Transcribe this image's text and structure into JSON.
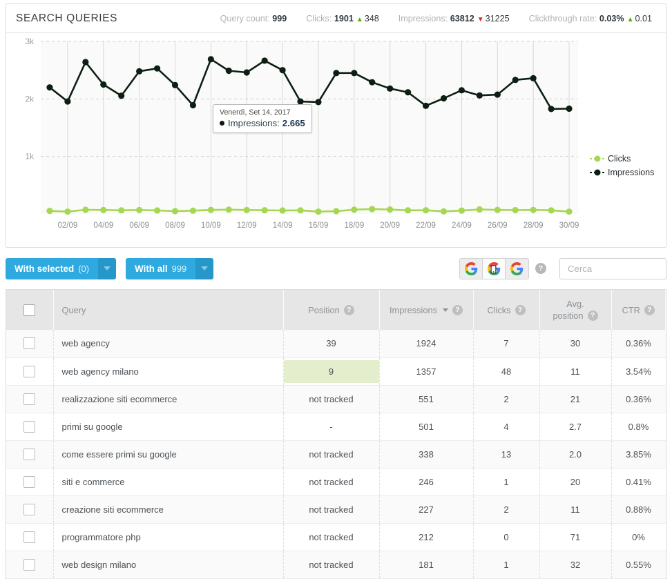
{
  "panel": {
    "title": "SEARCH QUERIES",
    "metrics": [
      {
        "label": "Query count:",
        "value": "999",
        "delta": "",
        "trend": "none"
      },
      {
        "label": "Clicks:",
        "value": "1901",
        "delta": "348",
        "trend": "up"
      },
      {
        "label": "Impressions:",
        "value": "63812",
        "delta": "31225",
        "trend": "down"
      },
      {
        "label": "Clickthrough rate:",
        "value": "0.03%",
        "delta": "0.01",
        "trend": "up"
      }
    ]
  },
  "chart_data": {
    "type": "line",
    "title": "",
    "xlabel": "",
    "ylabel": "",
    "ylim": [
      0,
      3000
    ],
    "yticks": [
      1000,
      2000,
      3000
    ],
    "ytick_labels": [
      "1k",
      "2k",
      "3k"
    ],
    "grid": true,
    "legend_position": "right",
    "x": [
      "01/09",
      "02/09",
      "03/09",
      "04/09",
      "05/09",
      "06/09",
      "07/09",
      "08/09",
      "09/09",
      "10/09",
      "11/09",
      "12/09",
      "13/09",
      "14/09",
      "15/09",
      "16/09",
      "17/09",
      "18/09",
      "19/09",
      "20/09",
      "21/09",
      "22/09",
      "23/09",
      "24/09",
      "25/09",
      "26/09",
      "27/09",
      "28/09",
      "29/09",
      "30/09"
    ],
    "xtick_labels": [
      "02/09",
      "04/09",
      "06/09",
      "08/09",
      "10/09",
      "12/09",
      "14/09",
      "16/09",
      "18/09",
      "20/09",
      "22/09",
      "24/09",
      "26/09",
      "28/09",
      "30/09"
    ],
    "series": [
      {
        "name": "Clicks",
        "color": "#a6d751",
        "values": [
          52,
          40,
          72,
          68,
          62,
          68,
          60,
          48,
          56,
          70,
          74,
          68,
          64,
          60,
          62,
          40,
          48,
          74,
          84,
          76,
          62,
          64,
          44,
          58,
          78,
          70,
          66,
          70,
          62,
          40
        ]
      },
      {
        "name": "Impressions",
        "color": "#0d1f12",
        "values": [
          2200,
          1955,
          2640,
          2250,
          2055,
          2480,
          2530,
          2240,
          1890,
          2690,
          2490,
          2460,
          2665,
          2500,
          1955,
          1945,
          2450,
          2450,
          2290,
          2180,
          2115,
          1880,
          2010,
          2150,
          2060,
          2075,
          2330,
          2360,
          1825,
          1830
        ]
      }
    ],
    "tooltip": {
      "date": "Venerdì, Set 14, 2017",
      "series": "Impressions:",
      "value": "2.665"
    }
  },
  "toolbar": {
    "with_selected_label": "With selected",
    "with_selected_count": "(0)",
    "with_all_label": "With all",
    "with_all_count": "999",
    "device_buttons": [
      {
        "name": "google-desktop",
        "icon": "google-icon",
        "active": false
      },
      {
        "name": "google-mobile",
        "icon": "google-mobile-icon",
        "active": true
      },
      {
        "name": "google-all",
        "icon": "google-icon",
        "active": false
      }
    ],
    "help_label": "?",
    "search_placeholder": "Cerca",
    "search_value": ""
  },
  "table": {
    "columns": [
      {
        "key": "check",
        "label": "",
        "help": false,
        "sorted": false
      },
      {
        "key": "query",
        "label": "Query",
        "help": false,
        "sorted": false
      },
      {
        "key": "position",
        "label": "Position",
        "help": true,
        "sorted": false
      },
      {
        "key": "impressions",
        "label": "Impressions",
        "help": true,
        "sorted": true
      },
      {
        "key": "clicks",
        "label": "Clicks",
        "help": true,
        "sorted": false
      },
      {
        "key": "avg_position",
        "label": "Avg.",
        "label2": "position",
        "help": true,
        "sorted": false
      },
      {
        "key": "ctr",
        "label": "CTR",
        "help": true,
        "sorted": false
      }
    ],
    "rows": [
      {
        "query": "web agency",
        "position": "39",
        "position_highlight": false,
        "impressions": "1924",
        "clicks": "7",
        "avg_position": "30",
        "ctr": "0.36%"
      },
      {
        "query": "web agency milano",
        "position": "9",
        "position_highlight": true,
        "impressions": "1357",
        "clicks": "48",
        "avg_position": "11",
        "ctr": "3.54%"
      },
      {
        "query": "realizzazione siti ecommerce",
        "position": "not tracked",
        "position_highlight": false,
        "impressions": "551",
        "clicks": "2",
        "avg_position": "21",
        "ctr": "0.36%"
      },
      {
        "query": "primi su google",
        "position": "-",
        "position_highlight": false,
        "impressions": "501",
        "clicks": "4",
        "avg_position": "2.7",
        "ctr": "0.8%"
      },
      {
        "query": "come essere primi su google",
        "position": "not tracked",
        "position_highlight": false,
        "impressions": "338",
        "clicks": "13",
        "avg_position": "2.0",
        "ctr": "3.85%"
      },
      {
        "query": "siti e commerce",
        "position": "not tracked",
        "position_highlight": false,
        "impressions": "246",
        "clicks": "1",
        "avg_position": "20",
        "ctr": "0.41%"
      },
      {
        "query": "creazione siti ecommerce",
        "position": "not tracked",
        "position_highlight": false,
        "impressions": "227",
        "clicks": "2",
        "avg_position": "11",
        "ctr": "0.88%"
      },
      {
        "query": "programmatore php",
        "position": "not tracked",
        "position_highlight": false,
        "impressions": "212",
        "clicks": "0",
        "avg_position": "71",
        "ctr": "0%"
      },
      {
        "query": "web design milano",
        "position": "not tracked",
        "position_highlight": false,
        "impressions": "181",
        "clicks": "1",
        "avg_position": "32",
        "ctr": "0.55%"
      }
    ]
  }
}
